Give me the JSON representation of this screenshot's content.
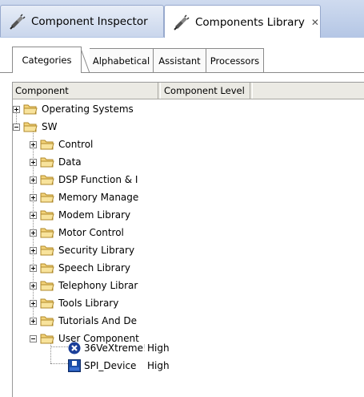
{
  "view_tabs": [
    {
      "label": "Component Inspector",
      "icon": "plug-icon",
      "active": false
    },
    {
      "label": "Components Library",
      "icon": "plug-icon",
      "active": true,
      "close": "✕"
    }
  ],
  "sub_tabs": [
    "Categories",
    "Alphabetical",
    "Assistant",
    "Processors"
  ],
  "columns": {
    "component": "Component",
    "level": "Component Level"
  },
  "tree": {
    "top": [
      {
        "label": "Operating Systems",
        "expanded": false
      },
      {
        "label": "SW",
        "expanded": true
      }
    ],
    "sw_children": [
      "Control",
      "Data",
      "DSP Function & I",
      "Memory Manage",
      "Modem Library",
      "Motor Control",
      "Security Library",
      "Speech Library",
      "Telephony Librar",
      "Tools Library",
      "Tutorials And De",
      "User Component"
    ],
    "user_components": [
      {
        "label": "36VeXtreme!",
        "level": "High",
        "icon": "blue-x-icon"
      },
      {
        "label": "SPI_Device",
        "level": "High",
        "icon": "spi-chip-icon"
      }
    ]
  },
  "colors": {
    "folder": "#f3d37a",
    "tab_border": "#97a9cd",
    "accent_blue": "#1b3f99"
  }
}
